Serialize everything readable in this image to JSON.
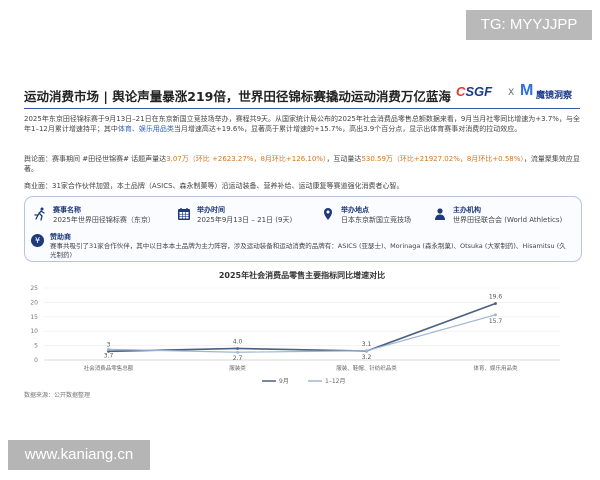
{
  "watermarks": {
    "top_right": "TG: MYYJJPP",
    "bottom_left": "www.kaniang.cn"
  },
  "header": {
    "title": "运动消费市场 | 舆论声量暴涨219倍，世界田径锦标赛撬动运动消费万亿蓝海",
    "logo_csgf_c": "C",
    "logo_csgf_rest": "SGF",
    "logo_sep": "X",
    "logo_m": "M",
    "logo_mjdc": "魔镜洞察"
  },
  "paragraphs": {
    "p1_a": "2025年东京田径锦标赛于9月13日–21日在东京新国立竞技场举办，赛程共9天。从国家统计局公布的2025年社会消费品零售总额数据来看，9月当月社零同比增速为+3.7%，与全年1–12月累计增速持平；其中",
    "p1_hl": "体育、娱乐用品类",
    "p1_b": "当月增速高达+19.6%，显著高于累计增速的+15.7%，高出3.9个百分点，显示出体育赛事对消费的拉动效应。",
    "p2_a": "舆论面：赛事期间 #田径世锦赛# 话题声量达",
    "p2_hl1": "3.07万（环比 +2623.27%，8月环比+126.10%）",
    "p2_b": "，互动量达",
    "p2_hl2": "530.59万（环比+21927.02%，8月环比+0.58%）",
    "p2_c": "，流量聚集效应显著。",
    "p3": "商业面：31家合作伙伴加盟，本土品牌（ASICS、森永制菓等）沿运动装备、营养补给、运动康复等赛道强化消费者心智。"
  },
  "facts": {
    "event_label": "赛事名称",
    "event_value": "2025年世界田径锦标赛（东京）",
    "time_label": "举办时间",
    "time_value": "2025年9月13日 – 21日 (9天)",
    "venue_label": "举办地点",
    "venue_value": "日本东京新国立竞技场",
    "org_label": "主办机构",
    "org_value": "世界田径联合会 (World Athletics)",
    "sponsor_label": "赞助商",
    "sponsor_value": "赛事共吸引了31家合作伙伴，其中以日本本土品牌为主力阵容，涉及运动装备和运动消费的品牌有：ASICS (亚瑟士)、Morinaga (森永制菓)、Otsuka (大冢制药)、Hisamitsu (久光制药)"
  },
  "icons": {
    "event": "runner-icon",
    "time": "calendar-icon",
    "venue": "location-pin-icon",
    "org": "person-icon",
    "sponsor": "yen-icon"
  },
  "chart_data": {
    "type": "line",
    "title": "2025年社会消费品零售主要指标同比增速对比",
    "categories": [
      "社会消费品零售总额",
      "服装类",
      "服装、鞋帽、针纺织品类",
      "体育、娱乐用品类"
    ],
    "series": [
      {
        "name": "9月",
        "values": [
          3.0,
          4.0,
          3.1,
          19.6
        ],
        "color": "#4a5f82"
      },
      {
        "name": "1–12月",
        "values": [
          3.7,
          2.7,
          3.2,
          15.7
        ],
        "color": "#9fb5d4"
      }
    ],
    "data_labels": [
      [
        "3",
        "4.0",
        "3.1",
        "19.6"
      ],
      [
        "3.7",
        "2.7",
        "3.2",
        "15.7"
      ]
    ],
    "y_ticks": [
      "0",
      "5",
      "10",
      "15",
      "20",
      "25"
    ],
    "ylim": [
      0,
      25
    ],
    "grid": true,
    "legend_position": "bottom-center"
  },
  "source": "数据来源：公开数据整理"
}
